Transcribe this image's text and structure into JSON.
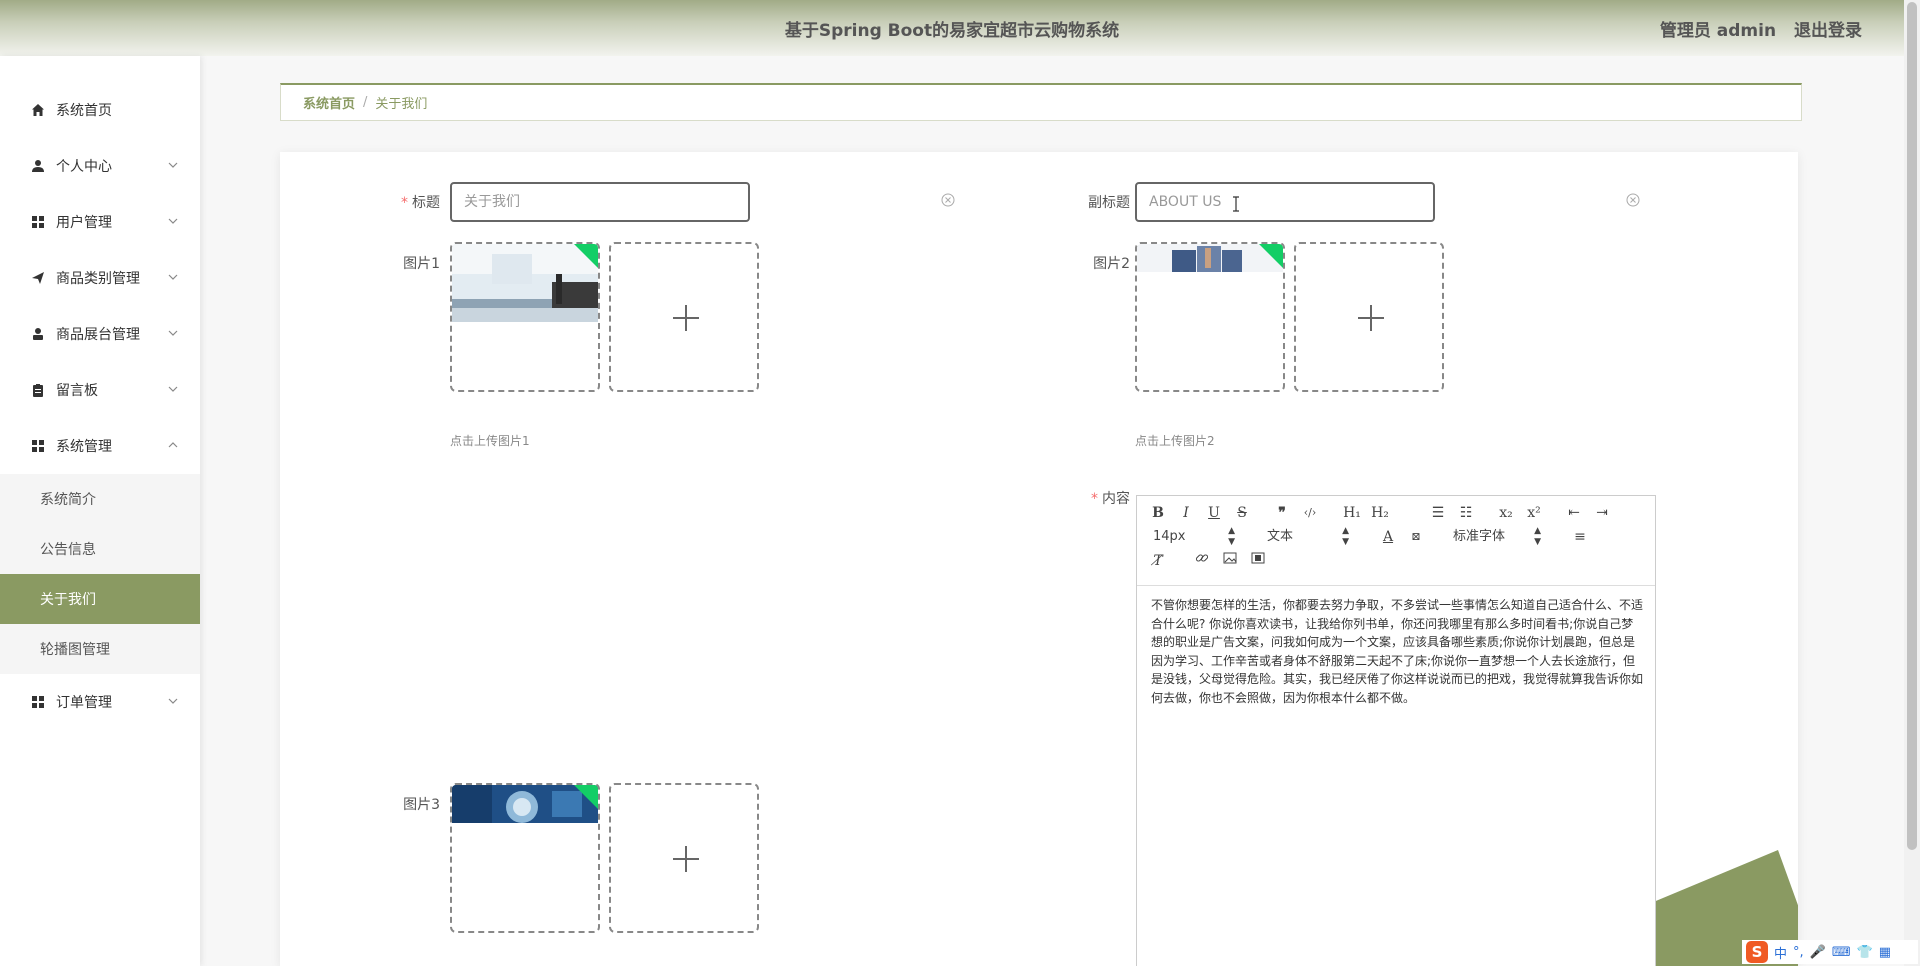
{
  "header": {
    "title": "基于Spring Boot的易家宜超市云购物系统",
    "user_label": "管理员 admin",
    "logout_label": "退出登录"
  },
  "sidebar": {
    "items": [
      {
        "label": "系统首页"
      },
      {
        "label": "个人中心"
      },
      {
        "label": "用户管理"
      },
      {
        "label": "商品类别管理"
      },
      {
        "label": "商品展台管理"
      },
      {
        "label": "留言板"
      },
      {
        "label": "系统管理"
      },
      {
        "label": "订单管理"
      }
    ],
    "system_sub": [
      {
        "label": "系统简介"
      },
      {
        "label": "公告信息"
      },
      {
        "label": "关于我们"
      },
      {
        "label": "轮播图管理"
      }
    ]
  },
  "breadcrumb": {
    "home": "系统首页",
    "separator": "/",
    "current": "关于我们"
  },
  "form": {
    "title_label": "标题",
    "title_value": "关于我们",
    "subtitle_label": "副标题",
    "subtitle_value": "ABOUT US",
    "pic1_label": "图片1",
    "pic1_hint": "点击上传图片1",
    "pic2_label": "图片2",
    "pic2_hint": "点击上传图片2",
    "pic3_label": "图片3",
    "content_label": "内容",
    "required_mark": "*"
  },
  "editor": {
    "font_size": "14px",
    "header_select": "文本",
    "font_family": "标准字体",
    "content": "不管你想要怎样的生活，你都要去努力争取，不多尝试一些事情怎么知道自己适合什么、不适合什么呢? 你说你喜欢读书，让我给你列书单，你还问我哪里有那么多时间看书;你说自己梦想的职业是广告文案，问我如何成为一个文案，应该具备哪些素质;你说你计划晨跑，但总是因为学习、工作辛苦或者身体不舒服第二天起不了床;你说你一直梦想一个人去长途旅行，但是没钱，父母觉得危险。其实，我已经厌倦了你这样说说而已的把戏，我觉得就算我告诉你如何去做，你也不会照做，因为你根本什么都不做。"
  },
  "ime": {
    "mode": "中"
  },
  "colors": {
    "accent": "#8a9a62",
    "required": "#f56c6c",
    "corner_badge": "#13ce66"
  }
}
